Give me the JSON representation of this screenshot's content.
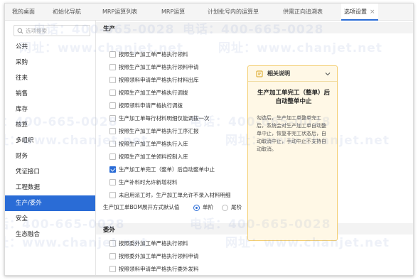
{
  "tabs": [
    {
      "label": "我的桌面"
    },
    {
      "label": "初始化导航"
    },
    {
      "label": "MRP运算列表"
    },
    {
      "label": "MRP运算"
    },
    {
      "label": "计划批号内的运算单"
    },
    {
      "label": "供需正向追溯表"
    },
    {
      "label": "选项设置",
      "active": true,
      "close": "×"
    }
  ],
  "sidebar": {
    "search_placeholder": "选项搜索",
    "items": [
      {
        "label": "公共"
      },
      {
        "label": "采购"
      },
      {
        "label": "往来"
      },
      {
        "label": "销售"
      },
      {
        "label": "库存"
      },
      {
        "label": "核算"
      },
      {
        "label": "多组织"
      },
      {
        "label": "财务"
      },
      {
        "label": "凭证接口"
      },
      {
        "label": "工程数据"
      },
      {
        "label": "生产/委外",
        "active": true
      },
      {
        "label": "安全"
      },
      {
        "label": "生态融合"
      }
    ]
  },
  "production": {
    "title": "生产",
    "options": [
      {
        "label": "按照生产加工单严格执行领料",
        "checked": false
      },
      {
        "label": "按照生产加工单严格执行领料申请",
        "checked": false
      },
      {
        "label": "按照领料申请单严格执行材料出库",
        "checked": false
      },
      {
        "label": "按照生产加工单严格执行调拨",
        "checked": false
      },
      {
        "label": "按照领料申请严格执行调拨",
        "checked": false
      },
      {
        "label": "生产加工单每行材料明细仅能调拨一次",
        "checked": false
      },
      {
        "label": "按照生产加工单严格执行工序汇报",
        "checked": false
      },
      {
        "label": "按照生产加工单严格执行入库",
        "checked": false
      },
      {
        "label": "按照生产加工单领料控制入库",
        "checked": false
      },
      {
        "label": "生产加工单完工（整单）后自动整单中止",
        "checked": true
      },
      {
        "label": "生产补料时允许新增材料",
        "checked": false
      },
      {
        "label": "未启用派工时，生产加工单允许不录入材料明细",
        "checked": false
      }
    ],
    "bom_label": "生产加工单BOM展开方式默认值",
    "radio_options": [
      {
        "label": "单阶",
        "selected": true
      },
      {
        "label": "尾阶",
        "selected": false
      }
    ]
  },
  "outsourcing": {
    "title": "委外",
    "options": [
      {
        "label": "按照委外加工单严格执行领料",
        "checked": false
      },
      {
        "label": "按照委外加工单严格执行领料申请",
        "checked": false
      },
      {
        "label": "按照领料申请单严格执行委外发料",
        "checked": false
      }
    ]
  },
  "help": {
    "header": "相关说明",
    "title": "生产加工单完工（整单）后自动整单中止",
    "body": "勾选后，生产加工单整单完工后，系统会对生产加工单自动整单中止，恢复非完工状态后，自动取消中止，手动中止不支持自动取消。"
  },
  "watermark": {
    "phone": "电话：400-665-0028",
    "site": "网址：www.chanjet.net"
  },
  "colors": {
    "accent": "#2a6cd6",
    "help_bg": "#fff8e6",
    "help_border": "#f4cf73"
  }
}
